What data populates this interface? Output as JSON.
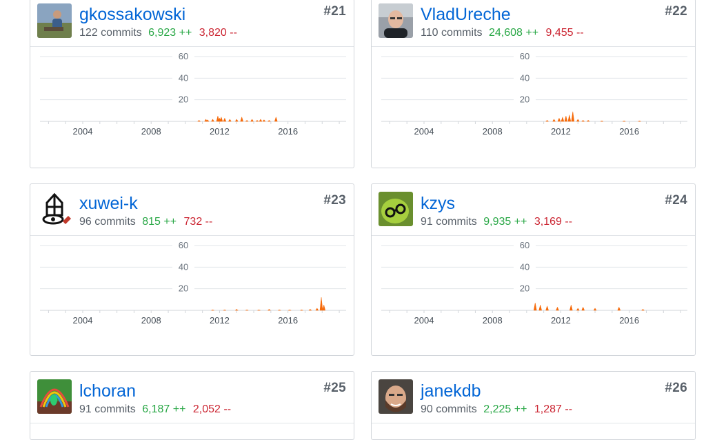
{
  "colors": {
    "link": "#0366d6",
    "additions": "#28a745",
    "deletions": "#cb2431",
    "chart_fill": "#f66a0a"
  },
  "contributors": [
    {
      "rank": "#21",
      "name": "gkossakowski",
      "commits": "122 commits",
      "additions": "6,923 ++",
      "deletions": "3,820 --",
      "avatar": "photo-outdoor-avatar",
      "activity": [
        [
          2010.8,
          1
        ],
        [
          2011.2,
          2
        ],
        [
          2011.3,
          1.5
        ],
        [
          2011.6,
          2
        ],
        [
          2011.9,
          5
        ],
        [
          2012.0,
          3
        ],
        [
          2012.1,
          4
        ],
        [
          2012.3,
          3
        ],
        [
          2012.6,
          2
        ],
        [
          2013.0,
          2
        ],
        [
          2013.3,
          4
        ],
        [
          2013.6,
          1
        ],
        [
          2013.9,
          2
        ],
        [
          2014.2,
          1
        ],
        [
          2014.4,
          2
        ],
        [
          2014.6,
          1.5
        ],
        [
          2014.9,
          1
        ],
        [
          2015.3,
          4
        ]
      ]
    },
    {
      "rank": "#22",
      "name": "VladUreche",
      "commits": "110 commits",
      "additions": "24,608 ++",
      "deletions": "9,455 --",
      "avatar": "photo-portrait-avatar",
      "activity": [
        [
          2011.2,
          1
        ],
        [
          2011.6,
          2
        ],
        [
          2011.9,
          3
        ],
        [
          2012.1,
          4
        ],
        [
          2012.3,
          5
        ],
        [
          2012.5,
          6
        ],
        [
          2012.7,
          9
        ],
        [
          2013.0,
          2
        ],
        [
          2013.3,
          1
        ],
        [
          2013.6,
          1
        ],
        [
          2014.4,
          0.5
        ],
        [
          2015.7,
          0.5
        ],
        [
          2016.6,
          0.5
        ]
      ]
    },
    {
      "rank": "#23",
      "name": "xuwei-k",
      "commits": "96 commits",
      "additions": "815 ++",
      "deletions": "732 --",
      "avatar": "drawn-lantern-avatar",
      "activity": [
        [
          2011.6,
          0.5
        ],
        [
          2012.3,
          0.5
        ],
        [
          2013.0,
          1
        ],
        [
          2013.6,
          0.5
        ],
        [
          2014.3,
          0.5
        ],
        [
          2014.9,
          1
        ],
        [
          2015.5,
          0.5
        ],
        [
          2016.1,
          0.5
        ],
        [
          2016.8,
          0.5
        ],
        [
          2017.3,
          1
        ],
        [
          2017.7,
          2
        ],
        [
          2017.95,
          12
        ],
        [
          2018.1,
          5
        ]
      ]
    },
    {
      "rank": "#24",
      "name": "kzys",
      "commits": "91 commits",
      "additions": "9,935 ++",
      "deletions": "3,169 --",
      "avatar": "green-glasses-avatar",
      "activity": [
        [
          2010.5,
          7
        ],
        [
          2010.8,
          5
        ],
        [
          2011.2,
          4
        ],
        [
          2011.8,
          3
        ],
        [
          2012.6,
          5
        ],
        [
          2013.0,
          2
        ],
        [
          2013.3,
          3
        ],
        [
          2014.0,
          2
        ],
        [
          2015.4,
          3
        ],
        [
          2016.8,
          1
        ]
      ]
    },
    {
      "rank": "#25",
      "name": "lchoran",
      "commits": "91 commits",
      "additions": "6,187 ++",
      "deletions": "2,052 --",
      "avatar": "rainbow-cartoon-avatar",
      "activity": []
    },
    {
      "rank": "#26",
      "name": "janekdb",
      "commits": "90 commits",
      "additions": "2,225 ++",
      "deletions": "1,287 --",
      "avatar": "photo-face-avatar",
      "activity": []
    }
  ],
  "chart_data": [
    {
      "type": "area",
      "title": "gkossakowski",
      "x_ticks": [
        "2004",
        "2008",
        "2012",
        "2016"
      ],
      "y_ticks": [
        "60",
        "40",
        "20"
      ],
      "ylim": [
        0,
        60
      ],
      "xlim": [
        2001.5,
        2019.4
      ]
    },
    {
      "type": "area",
      "title": "VladUreche",
      "x_ticks": [
        "2004",
        "2008",
        "2012",
        "2016"
      ],
      "y_ticks": [
        "60",
        "40",
        "20"
      ],
      "ylim": [
        0,
        60
      ],
      "xlim": [
        2001.5,
        2019.4
      ]
    },
    {
      "type": "area",
      "title": "xuwei-k",
      "x_ticks": [
        "2004",
        "2008",
        "2012",
        "2016"
      ],
      "y_ticks": [
        "60",
        "40",
        "20"
      ],
      "ylim": [
        0,
        60
      ],
      "xlim": [
        2001.5,
        2019.4
      ]
    },
    {
      "type": "area",
      "title": "kzys",
      "x_ticks": [
        "2004",
        "2008",
        "2012",
        "2016"
      ],
      "y_ticks": [
        "60",
        "40",
        "20"
      ],
      "ylim": [
        0,
        60
      ],
      "xlim": [
        2001.5,
        2019.4
      ]
    }
  ]
}
